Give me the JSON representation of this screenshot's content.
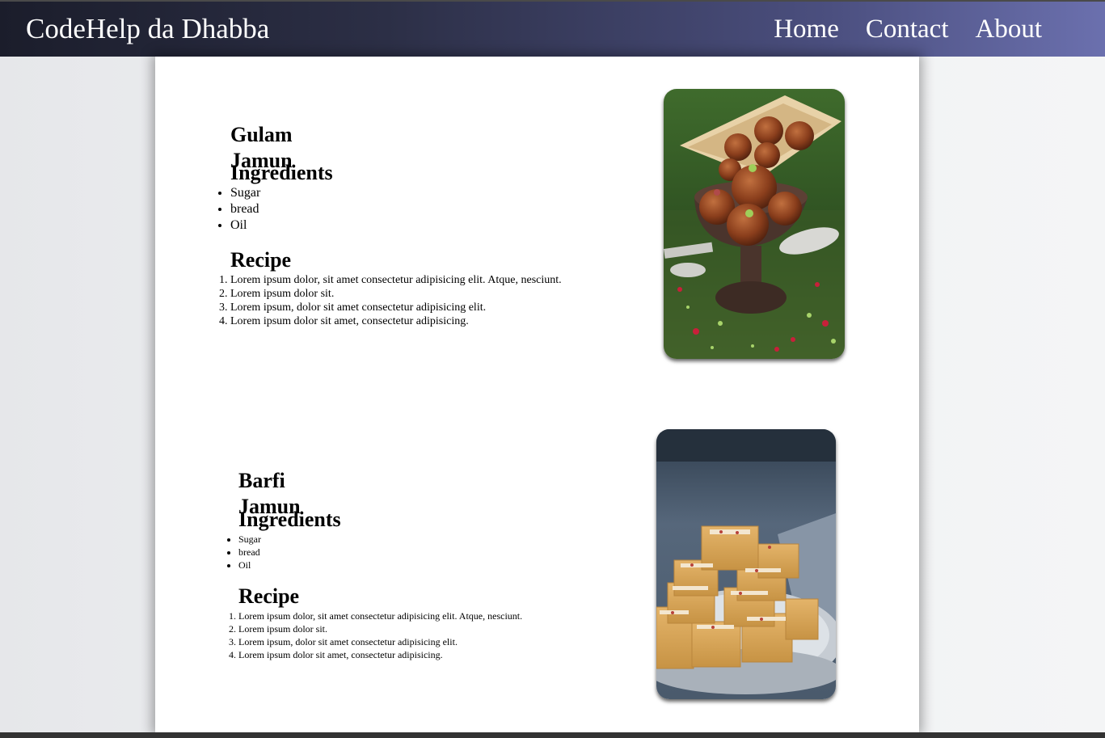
{
  "navbar": {
    "brand": "CodeHelp da Dhabba",
    "links": [
      "Home",
      "Contact",
      "About"
    ]
  },
  "recipes": [
    {
      "title": "Gulam Jamun",
      "ingredients_heading": "Ingredients",
      "ingredients": [
        "Sugar",
        "bread",
        "Oil"
      ],
      "recipe_heading": "Recipe",
      "steps": [
        "Lorem ipsum dolor, sit amet consectetur adipisicing elit. Atque, nesciunt.",
        "Lorem ipsum dolor sit.",
        "Lorem ipsum, dolor sit amet consectetur adipisicing elit.",
        "Lorem ipsum dolor sit amet, consectetur adipisicing."
      ]
    },
    {
      "title": "Barfi Jamun",
      "ingredients_heading": "Ingredients",
      "ingredients": [
        "Sugar",
        "bread",
        "Oil"
      ],
      "recipe_heading": "Recipe",
      "steps": [
        "Lorem ipsum dolor, sit amet consectetur adipisicing elit. Atque, nesciunt.",
        "Lorem ipsum dolor sit.",
        "Lorem ipsum, dolor sit amet consectetur adipisicing elit.",
        "Lorem ipsum dolor sit amet, consectetur adipisicing."
      ]
    }
  ],
  "colors": {
    "navbar_start": "#1b1d2b",
    "navbar_end": "#6b70ae",
    "navbar_text": "#ffffff",
    "page_background": "#eceef0",
    "card_background": "#ffffff"
  }
}
